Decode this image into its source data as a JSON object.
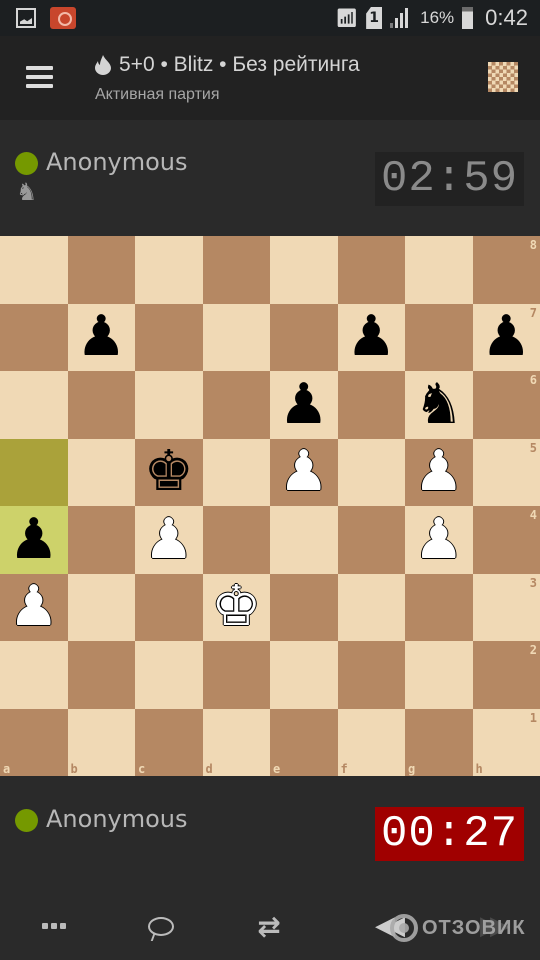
{
  "status_bar": {
    "left_icons": [
      "gallery-icon",
      "camera-icon"
    ],
    "battery_percent": "16%",
    "time": "0:42"
  },
  "header": {
    "menu_icon": "hamburger-menu-icon",
    "game_icon": "flame-icon",
    "title": "5+0 • Blitz • Без рейтинга",
    "subtitle": "Активная партия",
    "board_settings_icon": "chessboard-icon"
  },
  "opponent": {
    "name": "Anonymous",
    "online": true,
    "online_color": "#759900",
    "captured_pieces": [
      "♞"
    ],
    "clock": "02:59"
  },
  "player": {
    "name": "Anonymous",
    "online": true,
    "online_color": "#759900",
    "clock": "00:27",
    "clock_color": "#a00000"
  },
  "board": {
    "orientation": "white",
    "light_color": "#f0d9b5",
    "dark_color": "#b58863",
    "last_move": {
      "from": "a5",
      "to": "a4"
    },
    "files": [
      "a",
      "b",
      "c",
      "d",
      "e",
      "f",
      "g",
      "h"
    ],
    "ranks": [
      "8",
      "7",
      "6",
      "5",
      "4",
      "3",
      "2",
      "1"
    ],
    "pieces": [
      {
        "square": "b7",
        "color": "black",
        "type": "pawn",
        "glyph": "♟"
      },
      {
        "square": "f7",
        "color": "black",
        "type": "pawn",
        "glyph": "♟"
      },
      {
        "square": "h7",
        "color": "black",
        "type": "pawn",
        "glyph": "♟"
      },
      {
        "square": "e6",
        "color": "black",
        "type": "pawn",
        "glyph": "♟"
      },
      {
        "square": "g6",
        "color": "black",
        "type": "knight",
        "glyph": "♞"
      },
      {
        "square": "c5",
        "color": "black",
        "type": "king",
        "glyph": "♚"
      },
      {
        "square": "e5",
        "color": "white",
        "type": "pawn",
        "glyph": "♟"
      },
      {
        "square": "g5",
        "color": "white",
        "type": "pawn",
        "glyph": "♟"
      },
      {
        "square": "a4",
        "color": "black",
        "type": "pawn",
        "glyph": "♟"
      },
      {
        "square": "c4",
        "color": "white",
        "type": "pawn",
        "glyph": "♟"
      },
      {
        "square": "g4",
        "color": "white",
        "type": "pawn",
        "glyph": "♟"
      },
      {
        "square": "a3",
        "color": "white",
        "type": "pawn",
        "glyph": "♟"
      },
      {
        "square": "d3",
        "color": "white",
        "type": "king",
        "glyph": "♚"
      }
    ]
  },
  "bottom_bar": {
    "buttons": [
      {
        "name": "more-options",
        "icon": "more-dots-icon"
      },
      {
        "name": "chat",
        "icon": "chat-bubble-icon"
      },
      {
        "name": "flip-board",
        "icon": "flip-board-icon",
        "glyph": "⇄"
      },
      {
        "name": "previous-move",
        "icon": "rewind-icon",
        "glyph": "◀◀"
      },
      {
        "name": "next-move",
        "icon": "fast-forward-icon",
        "glyph": "▶▶"
      }
    ],
    "watermark": "ОТЗОВИК"
  }
}
